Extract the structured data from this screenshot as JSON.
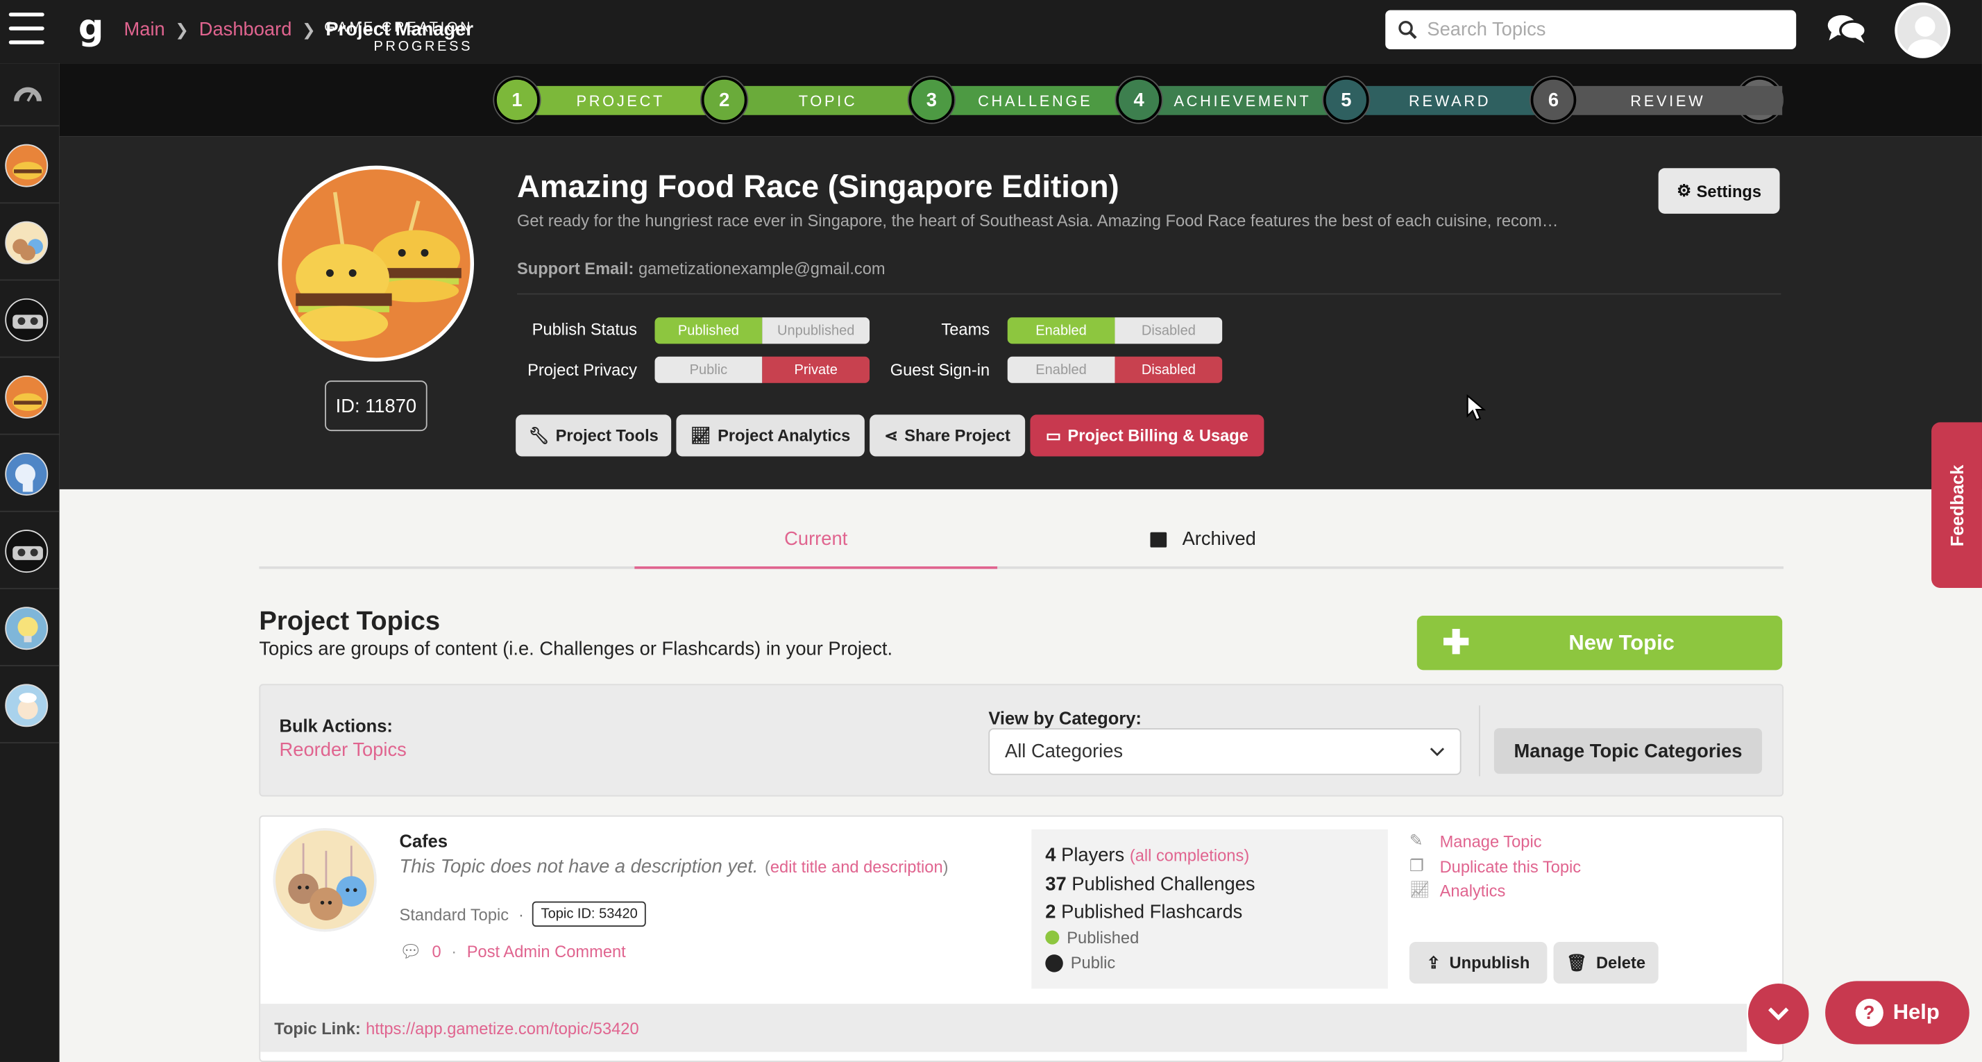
{
  "topbar": {
    "logo": "g",
    "breadcrumb": [
      "Main",
      "Dashboard",
      "Project Manager"
    ],
    "search_placeholder": "Search Topics"
  },
  "progress": {
    "label_line1": "GAME CREATION",
    "label_line2": "PROGRESS",
    "steps": [
      {
        "num": "1",
        "name": "PROJECT",
        "color": "#7cb83a"
      },
      {
        "num": "2",
        "name": "TOPIC",
        "color": "#6aab3a"
      },
      {
        "num": "3",
        "name": "CHALLENGE",
        "color": "#4d9a43"
      },
      {
        "num": "4",
        "name": "ACHIEVEMENT",
        "color": "#3d7f4e"
      },
      {
        "num": "5",
        "name": "REWARD",
        "color": "#2f6060"
      },
      {
        "num": "6",
        "name": "REVIEW",
        "color": "#555555"
      }
    ],
    "final_check": "✔"
  },
  "project": {
    "title": "Amazing Food Race (Singapore Edition)",
    "description": "Get ready for the hungriest race ever in Singapore, the heart of Southeast Asia. Amazing Food Race features the best of each cuisine, recom…",
    "support_label": "Support Email:",
    "support_email": "gametizationexample@gmail.com",
    "id_label": "ID: 11870",
    "settings_label": "Settings",
    "publish_status_label": "Publish Status",
    "publish_on": "Published",
    "publish_off": "Unpublished",
    "privacy_label": "Project Privacy",
    "privacy_public": "Public",
    "privacy_private": "Private",
    "teams_label": "Teams",
    "teams_enabled": "Enabled",
    "teams_disabled": "Disabled",
    "guest_label": "Guest Sign-in",
    "guest_enabled": "Enabled",
    "guest_disabled": "Disabled",
    "buttons": {
      "tools": "Project Tools",
      "analytics": "Project Analytics",
      "share": "Share Project",
      "billing": "Project Billing & Usage"
    }
  },
  "tabs": {
    "current": "Current",
    "archived": "Archived"
  },
  "topics_section": {
    "title": "Project Topics",
    "subtitle": "Topics are groups of content (i.e. Challenges or Flashcards) in your Project.",
    "new_topic": "New Topic",
    "bulk_label": "Bulk Actions:",
    "reorder": "Reorder Topics",
    "view_by_label": "View by Category:",
    "category_value": "All Categories",
    "manage_categories": "Manage Topic Categories"
  },
  "topic": {
    "name": "Cafes",
    "description": "This Topic does not have a description yet.",
    "edit_link": "edit title and description",
    "type": "Standard Topic",
    "topic_id": "Topic ID: 53420",
    "comment_count": "0",
    "post_comment": "Post Admin Comment",
    "players_num": "4",
    "players_label": "Players",
    "all_completions": "(all completions)",
    "challenges_num": "37",
    "challenges_label": "Published Challenges",
    "flashcards_num": "2",
    "flashcards_label": "Published Flashcards",
    "status": "Published",
    "privacy": "Public",
    "manage": "Manage Topic",
    "duplicate": "Duplicate this Topic",
    "analytics": "Analytics",
    "unpublish": "Unpublish",
    "delete": "Delete",
    "link_label": "Topic Link:",
    "link_url": "https://app.gametize.com/topic/53420"
  },
  "floating": {
    "feedback": "Feedback",
    "help": "Help"
  },
  "colors": {
    "accent_pink": "#e0648f",
    "green": "#8dc63f",
    "red": "#c8394f"
  }
}
